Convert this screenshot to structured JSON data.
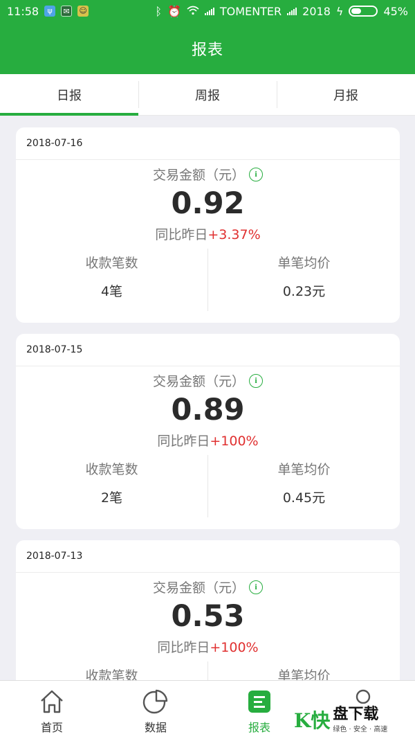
{
  "status_bar": {
    "time": "11:58",
    "carrier": "TOMENTER",
    "carrier2": "2018",
    "battery": "45%"
  },
  "header": {
    "title": "报表"
  },
  "tabs": [
    {
      "label": "日报",
      "active": true
    },
    {
      "label": "周报",
      "active": false
    },
    {
      "label": "月报",
      "active": false
    }
  ],
  "reports": [
    {
      "date": "2018-07-16",
      "amount_label": "交易金额（元）",
      "amount": "0.92",
      "compare_prefix": "同比昨日",
      "compare_value": "+3.37%",
      "count_label": "收款笔数",
      "count_value": "4笔",
      "avg_label": "单笔均价",
      "avg_value": "0.23元"
    },
    {
      "date": "2018-07-15",
      "amount_label": "交易金额（元）",
      "amount": "0.89",
      "compare_prefix": "同比昨日",
      "compare_value": "+100%",
      "count_label": "收款笔数",
      "count_value": "2笔",
      "avg_label": "单笔均价",
      "avg_value": "0.45元"
    },
    {
      "date": "2018-07-13",
      "amount_label": "交易金额（元）",
      "amount": "0.53",
      "compare_prefix": "同比昨日",
      "compare_value": "+100%",
      "count_label": "收款笔数",
      "count_value": "",
      "avg_label": "单笔均价",
      "avg_value": ""
    }
  ],
  "bottom_nav": [
    {
      "label": "首页",
      "icon": "home-icon",
      "active": false
    },
    {
      "label": "数据",
      "icon": "pie-chart-icon",
      "active": false
    },
    {
      "label": "报表",
      "icon": "report-icon",
      "active": true
    },
    {
      "label": "",
      "icon": "user-icon",
      "active": false
    }
  ],
  "watermark": {
    "mark": "K快",
    "title": "盘下载",
    "subtitle": "绿色 · 安全 · 高速"
  },
  "colors": {
    "brand_green": "#27ad3f",
    "increase_red": "#e03030",
    "background": "#efeff4"
  }
}
